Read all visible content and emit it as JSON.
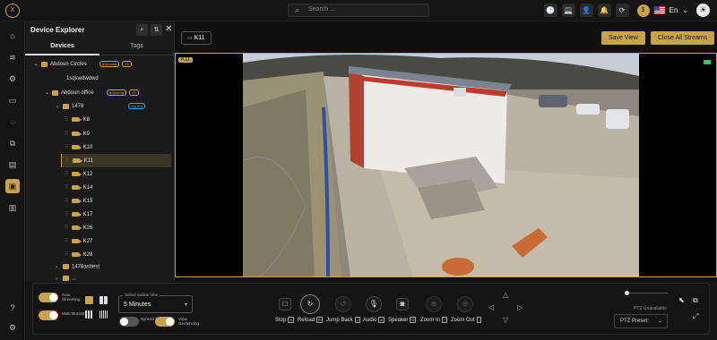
{
  "topbar": {
    "logo": "X",
    "search_placeholder": "Search ...",
    "coin": "$",
    "language": "En",
    "language_caret": "⌄",
    "mode_icon": "☀",
    "icons": [
      "🕐",
      "💻",
      "👤",
      "🔔",
      "⟳"
    ]
  },
  "explorer": {
    "title": "Device Explorer",
    "search_icon": "⌕",
    "sort_icon": "⇅",
    "close_icon": "✕",
    "tabs": [
      "Devices",
      "Tags"
    ],
    "active_tab": "Devices",
    "nodes": {
      "n0": {
        "label": "Abdoun Circles",
        "pill1": "testname",
        "pill2": "+2"
      },
      "n1": {
        "label": "1sqswdwdwd"
      },
      "n2": {
        "label": "Abdoun office",
        "pill1": "testname",
        "pill2": "+2"
      },
      "n3": {
        "label": "1478",
        "pill1": "tag test"
      },
      "k8": {
        "label": "K8"
      },
      "k9": {
        "label": "K9"
      },
      "k10": {
        "label": "K10"
      },
      "k11": {
        "label": "K11"
      },
      "k12": {
        "label": "K12"
      },
      "k14": {
        "label": "K14"
      },
      "k15": {
        "label": "K15"
      },
      "k17": {
        "label": "K17"
      },
      "k26": {
        "label": "K26"
      },
      "k27": {
        "label": "K27"
      },
      "k28": {
        "label": "K28"
      },
      "n4": {
        "label": "1478asttest"
      },
      "n5": {
        "label": "..."
      }
    }
  },
  "main": {
    "camera_tab": "K11",
    "save_view": "Save View",
    "close_all": "Close All Streams",
    "stream_label": "K11"
  },
  "controls": {
    "auto_streaming": "Auto Streaming",
    "multi_monitor": "Multi Monitor",
    "select_caption": "Select sodate time",
    "select_value": "5 Minutes",
    "synced_time": "Synced Time",
    "view_geofencing": "View Geofencing",
    "buttons": {
      "stop": {
        "label": "Stop",
        "key": "S"
      },
      "reload": {
        "label": "Reload",
        "key": "R"
      },
      "jump_back": {
        "label": "Jump Back",
        "key": "J"
      },
      "audio": {
        "label": "Audio",
        "key": "A"
      },
      "speaker": {
        "label": "Speaker",
        "key": "O"
      },
      "zoom_in": {
        "label": "Zoom In",
        "key": "+"
      },
      "zoom_out": {
        "label": "Zoom Out",
        "key": "-"
      }
    },
    "ptz_unavailable": "PTZ Unavailable",
    "ptz_preset": "PTZ Preset:",
    "ptz_preset_caret": "⌄"
  },
  "colors": {
    "accent": "#c9a34a",
    "live": "#3cc46a"
  }
}
